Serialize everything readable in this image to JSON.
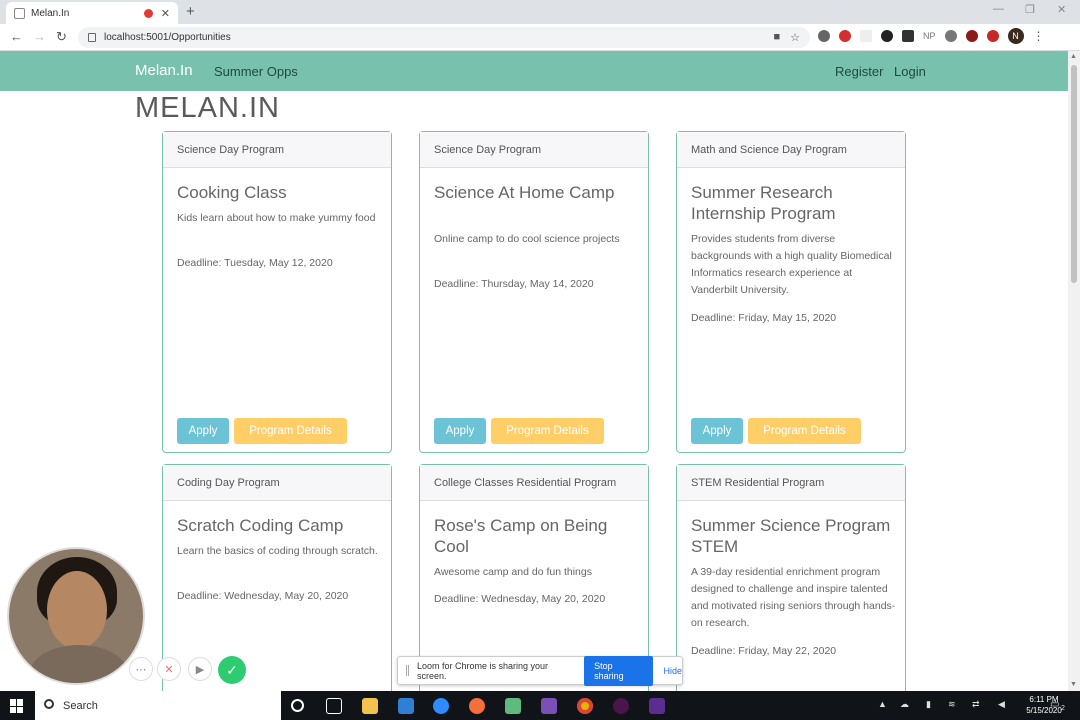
{
  "browser": {
    "tab_title": "Melan.In",
    "tab_close": "✕",
    "new_tab": "+",
    "url": "localhost:5001/Opportunities",
    "profile_initial": "N",
    "ext_label": "NP"
  },
  "navbar": {
    "brand": "Melan.In",
    "summer_opps": "Summer Opps",
    "register": "Register",
    "login": "Login"
  },
  "page": {
    "heading": "MELAN.IN"
  },
  "buttons": {
    "apply": "Apply",
    "details": "Program Details"
  },
  "cards": [
    {
      "header": "Science Day Program",
      "title": "Cooking Class",
      "description": "Kids learn about how to make yummy food",
      "deadline": "Deadline: Tuesday, May 12, 2020"
    },
    {
      "header": "Science Day Program",
      "title": "Science At Home Camp",
      "description": "Online camp to do cool science projects",
      "deadline": "Deadline: Thursday, May 14, 2020"
    },
    {
      "header": "Math and Science Day Program",
      "title": "Summer Research Internship Program",
      "description": "Provides students from diverse backgrounds with a high quality Biomedical Informatics research experience at Vanderbilt University.",
      "deadline": "Deadline: Friday, May 15, 2020"
    },
    {
      "header": "Coding Day Program",
      "title": "Scratch Coding Camp",
      "description": "Learn the basics of coding through scratch.",
      "deadline": "Deadline: Wednesday, May 20, 2020"
    },
    {
      "header": "College Classes Residential Program",
      "title": "Rose's Camp on Being Cool",
      "description": "Awesome camp and do fun things",
      "deadline": "Deadline: Wednesday, May 20, 2020"
    },
    {
      "header": "STEM Residential Program",
      "title": "Summer Science Program STEM",
      "description": "A 39-day residential enrichment program designed to challenge and inspire talented and motivated rising seniors through hands-on research.",
      "deadline": "Deadline: Friday, May 22, 2020"
    }
  ],
  "share_bar": {
    "message": "Loom for Chrome is sharing your screen.",
    "stop": "Stop sharing",
    "hide": "Hide"
  },
  "taskbar": {
    "search": "Search",
    "time": "6:11 PM",
    "date": "5/15/2020",
    "notification_count": "2"
  },
  "colors": {
    "navbar": "#78c2ad",
    "apply": "#6cc3d5",
    "details": "#ffce67",
    "stop_sharing": "#1a73e8"
  }
}
